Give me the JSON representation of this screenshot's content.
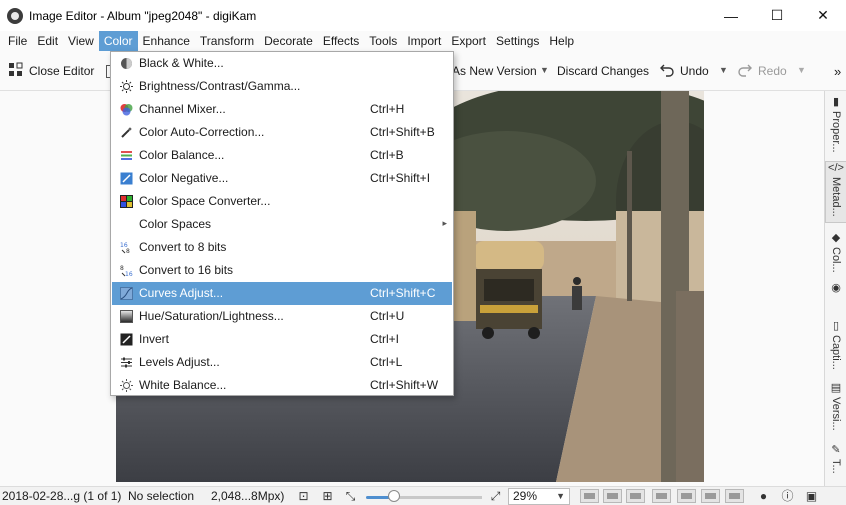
{
  "window": {
    "title": "Image Editor - Album \"jpeg2048\" - digiKam",
    "minimize": "—",
    "maximize": "☐",
    "close": "✕"
  },
  "menubar": [
    {
      "label": "File"
    },
    {
      "label": "Edit"
    },
    {
      "label": "View"
    },
    {
      "label": "Color"
    },
    {
      "label": "Enhance"
    },
    {
      "label": "Transform"
    },
    {
      "label": "Decorate"
    },
    {
      "label": "Effects"
    },
    {
      "label": "Tools"
    },
    {
      "label": "Import"
    },
    {
      "label": "Export"
    },
    {
      "label": "Settings"
    },
    {
      "label": "Help"
    }
  ],
  "toolbar": {
    "close_editor": "Close Editor",
    "save_as_new": "As New Version",
    "discard": "Discard Changes",
    "undo": "Undo",
    "redo": "Redo",
    "more": "»"
  },
  "color_menu": [
    {
      "label": "Black & White...",
      "shortcut": "",
      "icon": "bw-icon"
    },
    {
      "label": "Brightness/Contrast/Gamma...",
      "shortcut": "",
      "icon": "brightness-icon"
    },
    {
      "label": "Channel Mixer...",
      "shortcut": "Ctrl+H",
      "icon": "channel-mixer-icon"
    },
    {
      "label": "Color Auto-Correction...",
      "shortcut": "Ctrl+Shift+B",
      "icon": "auto-correction-icon"
    },
    {
      "label": "Color Balance...",
      "shortcut": "Ctrl+B",
      "icon": "color-balance-icon"
    },
    {
      "label": "Color Negative...",
      "shortcut": "Ctrl+Shift+I",
      "icon": "color-negative-icon"
    },
    {
      "label": "Color Space Converter...",
      "shortcut": "",
      "icon": "color-space-converter-icon"
    },
    {
      "label": "Color Spaces",
      "shortcut": "",
      "icon": "",
      "submenu": "▸"
    },
    {
      "label": "Convert to 8 bits",
      "shortcut": "",
      "icon": "convert-8bit-icon"
    },
    {
      "label": "Convert to 16 bits",
      "shortcut": "",
      "icon": "convert-16bit-icon"
    },
    {
      "label": "Curves Adjust...",
      "shortcut": "Ctrl+Shift+C",
      "icon": "curves-icon"
    },
    {
      "label": "Hue/Saturation/Lightness...",
      "shortcut": "Ctrl+U",
      "icon": "hsl-icon"
    },
    {
      "label": "Invert",
      "shortcut": "Ctrl+I",
      "icon": "invert-icon"
    },
    {
      "label": "Levels Adjust...",
      "shortcut": "Ctrl+L",
      "icon": "levels-icon"
    },
    {
      "label": "White Balance...",
      "shortcut": "Ctrl+Shift+W",
      "icon": "white-balance-icon"
    }
  ],
  "right_tabs": [
    {
      "label": "Proper...",
      "icon": "properties-icon"
    },
    {
      "label": "Metad...",
      "icon": "metadata-icon"
    },
    {
      "label": "Col...",
      "icon": "colors-icon"
    },
    {
      "label": "",
      "icon": "geolocation-icon"
    },
    {
      "label": "Capti...",
      "icon": "captions-icon"
    },
    {
      "label": "Versi...",
      "icon": "versions-icon"
    },
    {
      "label": "T...",
      "icon": "tools-icon"
    }
  ],
  "statusbar": {
    "filename": "2018-02-28...g (1 of 1)",
    "selection": "No selection",
    "size": "2,048...8Mpx)",
    "zoom": "29%",
    "zoom_slider_fraction": 0.28
  },
  "colors": {
    "accent": "#5e9dd4",
    "highlight_text": "#ffffff"
  }
}
